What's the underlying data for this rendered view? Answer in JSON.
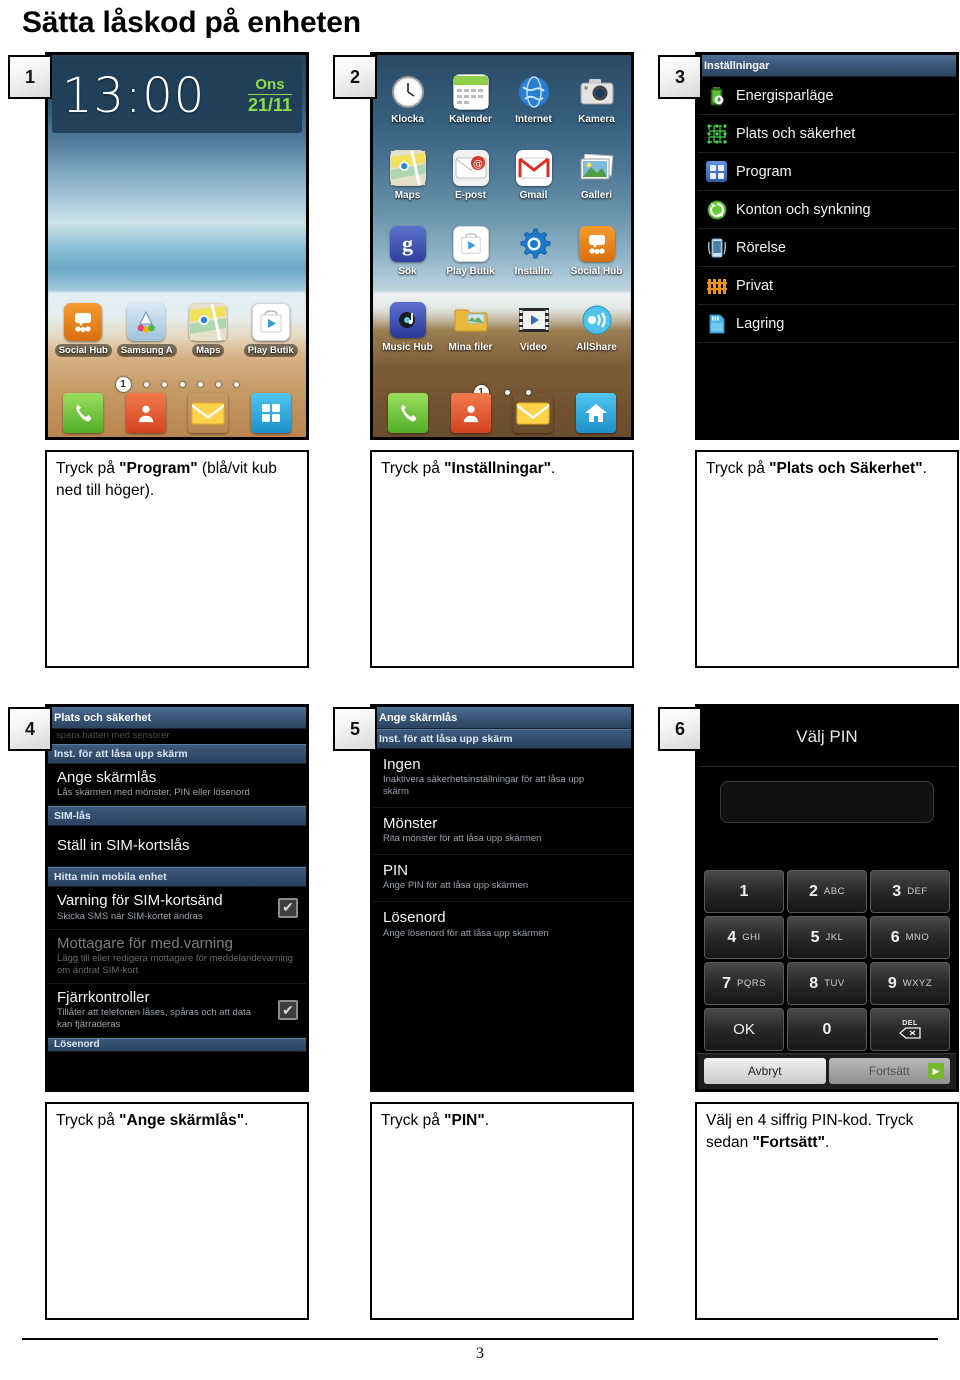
{
  "document": {
    "title": "Sätta låskod på enheten",
    "page_number": "3"
  },
  "steps": [
    {
      "number": "1",
      "caption_prefix": "Tryck på ",
      "caption_bold": "\"Program\"",
      "caption_suffix": " (blå/vit kub ned till höger)."
    },
    {
      "number": "2",
      "caption_prefix": "Tryck på ",
      "caption_bold": "\"Inställningar\"",
      "caption_suffix": "."
    },
    {
      "number": "3",
      "caption_prefix": "Tryck på ",
      "caption_bold": "\"Plats och Säkerhet\"",
      "caption_suffix": "."
    },
    {
      "number": "4",
      "caption_prefix": "Tryck på ",
      "caption_bold": "\"Ange skärmlås\"",
      "caption_suffix": "."
    },
    {
      "number": "5",
      "caption_prefix": "Tryck på ",
      "caption_bold": "\"PIN\"",
      "caption_suffix": "."
    },
    {
      "number": "6",
      "caption_prefix": "Välj en 4 siffrig PIN-kod. Tryck sedan ",
      "caption_bold": "\"Fortsätt\"",
      "caption_suffix": "."
    }
  ],
  "screen1": {
    "clock": {
      "time": "13:00",
      "day": "Ons",
      "date": "21/11"
    },
    "apps": [
      {
        "label": "Social Hub",
        "icon": "social-hub-icon",
        "color": "#e8821e"
      },
      {
        "label": "Samsung A",
        "icon": "samsung-apps-icon",
        "color": "#cfe2f0"
      },
      {
        "label": "Maps",
        "icon": "maps-icon",
        "color": "#d9d4bf"
      },
      {
        "label": "Play Butik",
        "icon": "play-store-icon",
        "color": "#ffffff"
      }
    ],
    "page_indicator": {
      "current": "1",
      "total_dots": 7
    },
    "dock": [
      {
        "label": "phone-icon",
        "color": "#6dbd3a"
      },
      {
        "label": "contacts-icon",
        "color": "#e45c2b"
      },
      {
        "label": "messages-icon",
        "color": "#f6c842"
      },
      {
        "label": "apps-grid-icon",
        "color": "#2ba6dd"
      }
    ]
  },
  "screen2": {
    "apps": [
      {
        "label": "Klocka",
        "icon": "clock-icon",
        "color": "#f2f2f2"
      },
      {
        "label": "Kalender",
        "icon": "calendar-icon",
        "color": "#8fd04a"
      },
      {
        "label": "Internet",
        "icon": "globe-icon",
        "color": "#2a7fd4"
      },
      {
        "label": "Kamera",
        "icon": "camera-icon",
        "color": "#d6d6d6"
      },
      {
        "label": "Maps",
        "icon": "maps-icon",
        "color": "#d9d4bf"
      },
      {
        "label": "E-post",
        "icon": "email-icon",
        "color": "#e8e8e8"
      },
      {
        "label": "Gmail",
        "icon": "gmail-icon",
        "color": "#ffffff"
      },
      {
        "label": "Galleri",
        "icon": "gallery-icon",
        "color": "#8fbf6a"
      },
      {
        "label": "Sök",
        "icon": "google-search-icon",
        "color": "#3a56b5"
      },
      {
        "label": "Play Butik",
        "icon": "play-store-icon",
        "color": "#ffffff"
      },
      {
        "label": "Inställn.",
        "icon": "settings-gear-icon",
        "color": "#1f78c8"
      },
      {
        "label": "Social Hub",
        "icon": "social-hub-icon",
        "color": "#e8821e"
      },
      {
        "label": "Music Hub",
        "icon": "music-hub-icon",
        "color": "#3b4ea8"
      },
      {
        "label": "Mina filer",
        "icon": "folder-icon",
        "color": "#e8b93c"
      },
      {
        "label": "Video",
        "icon": "video-icon",
        "color": "#cfcfcf"
      },
      {
        "label": "AllShare",
        "icon": "allshare-icon",
        "color": "#3fb8e8"
      }
    ],
    "page_indicator": {
      "current": "1",
      "total_dots": 3
    },
    "dock": [
      {
        "label": "phone-icon",
        "color": "#6dbd3a"
      },
      {
        "label": "contacts-icon",
        "color": "#e45c2b"
      },
      {
        "label": "messages-icon",
        "color": "#f6c842"
      },
      {
        "label": "home-icon",
        "color": "#2ba6dd"
      }
    ]
  },
  "screen3": {
    "titlebar": "Inställningar",
    "items": [
      {
        "label": "Energisparläge",
        "icon": "battery-eco-icon",
        "color": "#5fbf3d"
      },
      {
        "label": "Plats och säkerhet",
        "icon": "location-grid-icon",
        "color": "#3ddc48"
      },
      {
        "label": "Program",
        "icon": "apps-grid-icon",
        "color": "#4f86d6"
      },
      {
        "label": "Konton och synkning",
        "icon": "sync-icon",
        "color": "#66cc33"
      },
      {
        "label": "Rörelse",
        "icon": "motion-phone-icon",
        "color": "#8fc4e8"
      },
      {
        "label": "Privat",
        "icon": "privacy-fence-icon",
        "color": "#e8931e"
      },
      {
        "label": "Lagring",
        "icon": "storage-card-icon",
        "color": "#4fb8e8"
      }
    ]
  },
  "screen4": {
    "titlebar": "Plats och säkerhet",
    "partial_top_sub": "spara batteri med sensorer",
    "sections": [
      {
        "header": "Inst. för att låsa upp skärm",
        "rows": [
          {
            "title": "Ange skärmlås",
            "sub": "Lås skärmen med mönster, PIN eller lösenord",
            "checkbox": false,
            "dim": false
          }
        ]
      },
      {
        "header": "SIM-lås",
        "rows": [
          {
            "title": "Ställ in SIM-kortslås",
            "sub": "",
            "checkbox": false,
            "dim": false
          }
        ]
      },
      {
        "header": "Hitta min mobila enhet",
        "rows": [
          {
            "title": "Varning för SIM-kortsänd",
            "sub": "Skicka SMS när SIM-kortet ändras",
            "checkbox": true,
            "dim": false
          },
          {
            "title": "Mottagare för med.varning",
            "sub": "Lägg till eller redigera mottagare för meddelandevarning om ändrat SIM-kort",
            "checkbox": false,
            "dim": true
          },
          {
            "title": "Fjärrkontroller",
            "sub": "Tillåter att telefonen låses, spåras och att data kan fjärraderas",
            "checkbox": true,
            "dim": false
          }
        ]
      }
    ],
    "partial_bottom_header": "Lösenord"
  },
  "screen5": {
    "titlebar": "Ange skärmlås",
    "subbar": "Inst. för att låsa upp skärm",
    "rows": [
      {
        "title": "Ingen",
        "sub": "Inaktivera säkerhetsinställningar för att låsa upp skärm"
      },
      {
        "title": "Mönster",
        "sub": "Rita mönster för att låsa upp skärmen"
      },
      {
        "title": "PIN",
        "sub": "Ange PIN för att låsa upp skärmen"
      },
      {
        "title": "Lösenord",
        "sub": "Ange lösenord för att låsa upp skärmen"
      }
    ]
  },
  "screen6": {
    "title": "Välj PIN",
    "pin_value": "",
    "keys": [
      {
        "num": "1",
        "letters": ""
      },
      {
        "num": "2",
        "letters": "ABC"
      },
      {
        "num": "3",
        "letters": "DEF"
      },
      {
        "num": "4",
        "letters": "GHI"
      },
      {
        "num": "5",
        "letters": "JKL"
      },
      {
        "num": "6",
        "letters": "MNO"
      },
      {
        "num": "7",
        "letters": "PQRS"
      },
      {
        "num": "8",
        "letters": "TUV"
      },
      {
        "num": "9",
        "letters": "WXYZ"
      },
      {
        "num": "OK",
        "letters": ""
      },
      {
        "num": "0",
        "letters": ""
      },
      {
        "num": "DEL",
        "letters": ""
      }
    ],
    "cancel_label": "Avbryt",
    "continue_label": "Fortsätt"
  }
}
